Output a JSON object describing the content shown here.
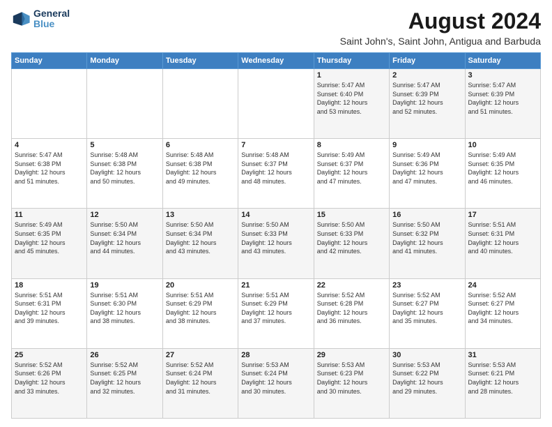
{
  "logo": {
    "line1": "General",
    "line2": "Blue"
  },
  "title": "August 2024",
  "subtitle": "Saint John's, Saint John, Antigua and Barbuda",
  "weekdays": [
    "Sunday",
    "Monday",
    "Tuesday",
    "Wednesday",
    "Thursday",
    "Friday",
    "Saturday"
  ],
  "weeks": [
    [
      {
        "day": "",
        "info": ""
      },
      {
        "day": "",
        "info": ""
      },
      {
        "day": "",
        "info": ""
      },
      {
        "day": "",
        "info": ""
      },
      {
        "day": "1",
        "info": "Sunrise: 5:47 AM\nSunset: 6:40 PM\nDaylight: 12 hours\nand 53 minutes."
      },
      {
        "day": "2",
        "info": "Sunrise: 5:47 AM\nSunset: 6:39 PM\nDaylight: 12 hours\nand 52 minutes."
      },
      {
        "day": "3",
        "info": "Sunrise: 5:47 AM\nSunset: 6:39 PM\nDaylight: 12 hours\nand 51 minutes."
      }
    ],
    [
      {
        "day": "4",
        "info": "Sunrise: 5:47 AM\nSunset: 6:38 PM\nDaylight: 12 hours\nand 51 minutes."
      },
      {
        "day": "5",
        "info": "Sunrise: 5:48 AM\nSunset: 6:38 PM\nDaylight: 12 hours\nand 50 minutes."
      },
      {
        "day": "6",
        "info": "Sunrise: 5:48 AM\nSunset: 6:38 PM\nDaylight: 12 hours\nand 49 minutes."
      },
      {
        "day": "7",
        "info": "Sunrise: 5:48 AM\nSunset: 6:37 PM\nDaylight: 12 hours\nand 48 minutes."
      },
      {
        "day": "8",
        "info": "Sunrise: 5:49 AM\nSunset: 6:37 PM\nDaylight: 12 hours\nand 47 minutes."
      },
      {
        "day": "9",
        "info": "Sunrise: 5:49 AM\nSunset: 6:36 PM\nDaylight: 12 hours\nand 47 minutes."
      },
      {
        "day": "10",
        "info": "Sunrise: 5:49 AM\nSunset: 6:35 PM\nDaylight: 12 hours\nand 46 minutes."
      }
    ],
    [
      {
        "day": "11",
        "info": "Sunrise: 5:49 AM\nSunset: 6:35 PM\nDaylight: 12 hours\nand 45 minutes."
      },
      {
        "day": "12",
        "info": "Sunrise: 5:50 AM\nSunset: 6:34 PM\nDaylight: 12 hours\nand 44 minutes."
      },
      {
        "day": "13",
        "info": "Sunrise: 5:50 AM\nSunset: 6:34 PM\nDaylight: 12 hours\nand 43 minutes."
      },
      {
        "day": "14",
        "info": "Sunrise: 5:50 AM\nSunset: 6:33 PM\nDaylight: 12 hours\nand 43 minutes."
      },
      {
        "day": "15",
        "info": "Sunrise: 5:50 AM\nSunset: 6:33 PM\nDaylight: 12 hours\nand 42 minutes."
      },
      {
        "day": "16",
        "info": "Sunrise: 5:50 AM\nSunset: 6:32 PM\nDaylight: 12 hours\nand 41 minutes."
      },
      {
        "day": "17",
        "info": "Sunrise: 5:51 AM\nSunset: 6:31 PM\nDaylight: 12 hours\nand 40 minutes."
      }
    ],
    [
      {
        "day": "18",
        "info": "Sunrise: 5:51 AM\nSunset: 6:31 PM\nDaylight: 12 hours\nand 39 minutes."
      },
      {
        "day": "19",
        "info": "Sunrise: 5:51 AM\nSunset: 6:30 PM\nDaylight: 12 hours\nand 38 minutes."
      },
      {
        "day": "20",
        "info": "Sunrise: 5:51 AM\nSunset: 6:29 PM\nDaylight: 12 hours\nand 38 minutes."
      },
      {
        "day": "21",
        "info": "Sunrise: 5:51 AM\nSunset: 6:29 PM\nDaylight: 12 hours\nand 37 minutes."
      },
      {
        "day": "22",
        "info": "Sunrise: 5:52 AM\nSunset: 6:28 PM\nDaylight: 12 hours\nand 36 minutes."
      },
      {
        "day": "23",
        "info": "Sunrise: 5:52 AM\nSunset: 6:27 PM\nDaylight: 12 hours\nand 35 minutes."
      },
      {
        "day": "24",
        "info": "Sunrise: 5:52 AM\nSunset: 6:27 PM\nDaylight: 12 hours\nand 34 minutes."
      }
    ],
    [
      {
        "day": "25",
        "info": "Sunrise: 5:52 AM\nSunset: 6:26 PM\nDaylight: 12 hours\nand 33 minutes."
      },
      {
        "day": "26",
        "info": "Sunrise: 5:52 AM\nSunset: 6:25 PM\nDaylight: 12 hours\nand 32 minutes."
      },
      {
        "day": "27",
        "info": "Sunrise: 5:52 AM\nSunset: 6:24 PM\nDaylight: 12 hours\nand 31 minutes."
      },
      {
        "day": "28",
        "info": "Sunrise: 5:53 AM\nSunset: 6:24 PM\nDaylight: 12 hours\nand 30 minutes."
      },
      {
        "day": "29",
        "info": "Sunrise: 5:53 AM\nSunset: 6:23 PM\nDaylight: 12 hours\nand 30 minutes."
      },
      {
        "day": "30",
        "info": "Sunrise: 5:53 AM\nSunset: 6:22 PM\nDaylight: 12 hours\nand 29 minutes."
      },
      {
        "day": "31",
        "info": "Sunrise: 5:53 AM\nSunset: 6:21 PM\nDaylight: 12 hours\nand 28 minutes."
      }
    ]
  ]
}
